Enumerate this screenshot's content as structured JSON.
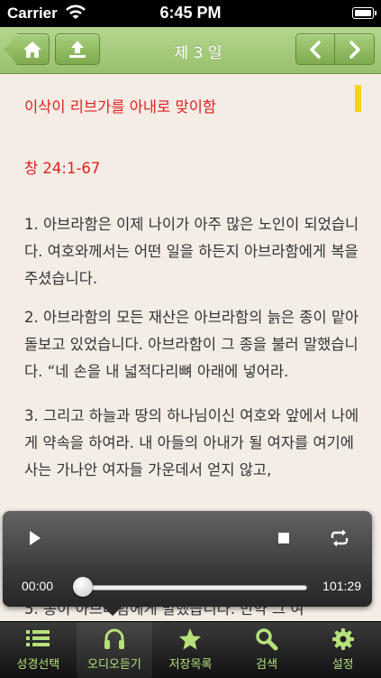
{
  "status_bar": {
    "carrier": "Carrier",
    "time": "6:45 PM"
  },
  "nav": {
    "title": "제 3 일"
  },
  "content": {
    "chapter_title": "이삭이 리브가를 아내로 맞이함",
    "reference": "창 24:1-67",
    "verses": [
      "1. 아브라함은 이제 나이가 아주 많은 노인이 되었습니다. 여호와께서는 어떤 일을 하든지 아브라함에게 복을 주셨습니다.",
      "2. 아브라함의 모든 재산은 아브라함의 늙은 종이 맡아 돌보고 있었습니다. 아브라함이 그 종을 불러 말했습니다. “네 손을 내 넓적다리뼈 아래에 넣어라.",
      "3. 그리고 하늘과 땅의 하나님이신 여호와 앞에서 나에게 약속을 하여라. 내 아들의 아내가 될 여자를 여기에 사는 가나안 여자들 가운데서 얻지 않고,",
      "5. 종이 아브라함에게 말했습니다. 만약 그 여"
    ]
  },
  "player": {
    "current_time": "00:00",
    "total_time": "101:29",
    "progress": 0.0
  },
  "tabs": [
    {
      "label": "성경선택",
      "icon": "list-icon"
    },
    {
      "label": "오디오듣기",
      "icon": "headphones-icon"
    },
    {
      "label": "저장목록",
      "icon": "star-icon"
    },
    {
      "label": "검색",
      "icon": "search-icon"
    },
    {
      "label": "설정",
      "icon": "gear-icon"
    }
  ],
  "colors": {
    "nav_green": "#98c06c",
    "tab_label": "#b6e07b",
    "title_red": "#e02020",
    "bookmark_yellow": "#f7d21a"
  }
}
